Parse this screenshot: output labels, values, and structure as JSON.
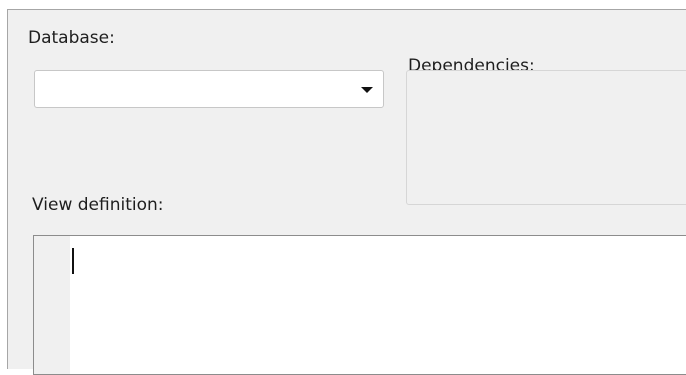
{
  "database": {
    "label": "Database:",
    "selected_value": ""
  },
  "dependencies": {
    "label": "Dependencies:"
  },
  "view_definition": {
    "label": "View definition:",
    "text": ""
  },
  "icons": {
    "dropdown": "chevron-down-icon"
  },
  "colors": {
    "panel_background": "#f0f0f0",
    "field_background": "#ffffff",
    "border": "#a6a6a6"
  }
}
